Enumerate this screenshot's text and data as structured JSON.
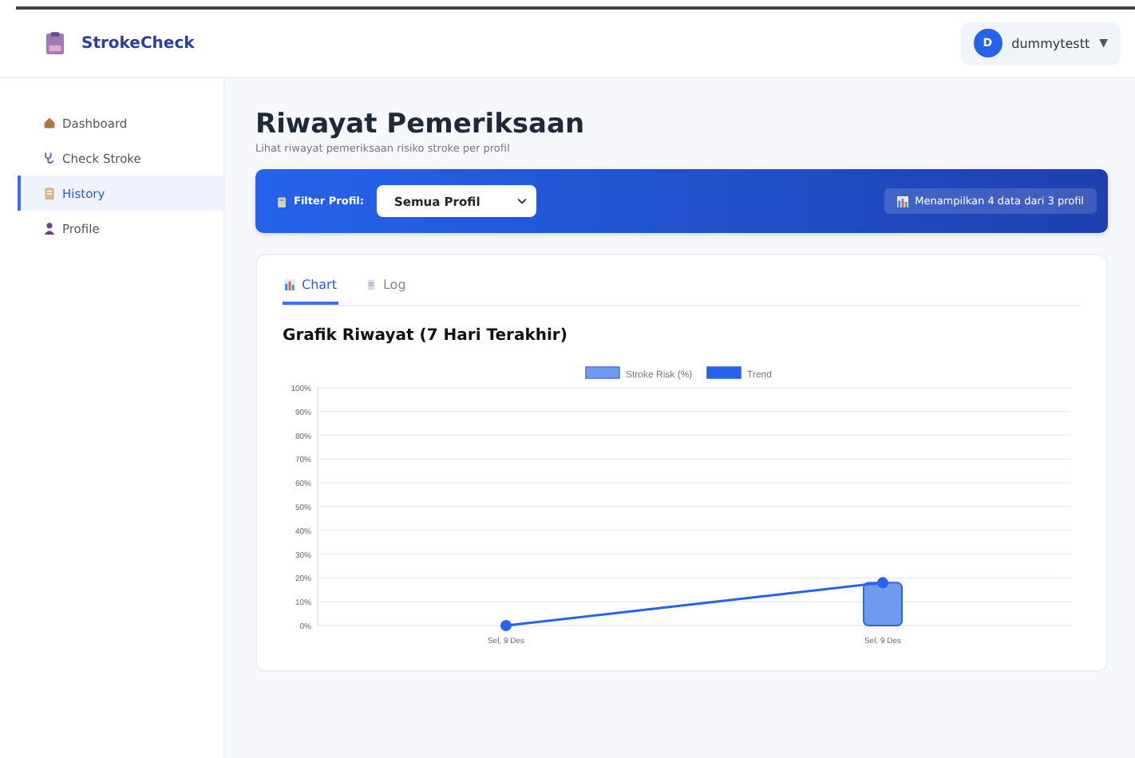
{
  "app": {
    "name": "StrokeCheck"
  },
  "user": {
    "initial": "D",
    "name": "dummytestt",
    "caret": "▼"
  },
  "sidebar": {
    "items": [
      {
        "label": "Dashboard",
        "kind": "home",
        "selected": false
      },
      {
        "label": "Check Stroke",
        "kind": "stethoscope",
        "selected": false
      },
      {
        "label": "History",
        "kind": "clipboard",
        "selected": true
      },
      {
        "label": "Profile",
        "kind": "person",
        "selected": false
      }
    ]
  },
  "page": {
    "title": "Riwayat Pemeriksaan",
    "subtitle": "Lihat riwayat pemeriksaan risiko stroke per profil"
  },
  "filter": {
    "label": "Filter Profil:",
    "value": "Semua Profil",
    "summary": "Menampilkan 4 data dari 3 profil"
  },
  "tabs": [
    {
      "label": "Chart",
      "kind": "chart",
      "selected": true
    },
    {
      "label": "Log",
      "kind": "log",
      "selected": false
    }
  ],
  "chart_title": "Grafik Riwayat (7 Hari Terakhir)",
  "chart_data": {
    "type": "bar",
    "categories": [
      "Sel, 9 Des",
      "Sel, 9 Des"
    ],
    "series": [
      {
        "name": "Stroke Risk (%)",
        "color": "#6f9af0",
        "values": [
          0,
          18
        ]
      },
      {
        "name": "Trend",
        "type": "line",
        "marker": "circle",
        "color": "#2563eb",
        "values": [
          0,
          18
        ]
      }
    ],
    "ylim": [
      0,
      100
    ],
    "grid": true,
    "legend": "top",
    "yticks": [
      {
        "value": 0,
        "label": "0%"
      },
      {
        "value": 10,
        "label": "10%"
      },
      {
        "value": 20,
        "label": "20%"
      },
      {
        "value": 30,
        "label": "30%"
      },
      {
        "value": 40,
        "label": "40%"
      },
      {
        "value": 50,
        "label": "50%"
      },
      {
        "value": 60,
        "label": "60%"
      },
      {
        "value": 70,
        "label": "70%"
      },
      {
        "value": 80,
        "label": "80%"
      },
      {
        "value": 90,
        "label": "90%"
      },
      {
        "value": 100,
        "label": "100%"
      }
    ]
  }
}
